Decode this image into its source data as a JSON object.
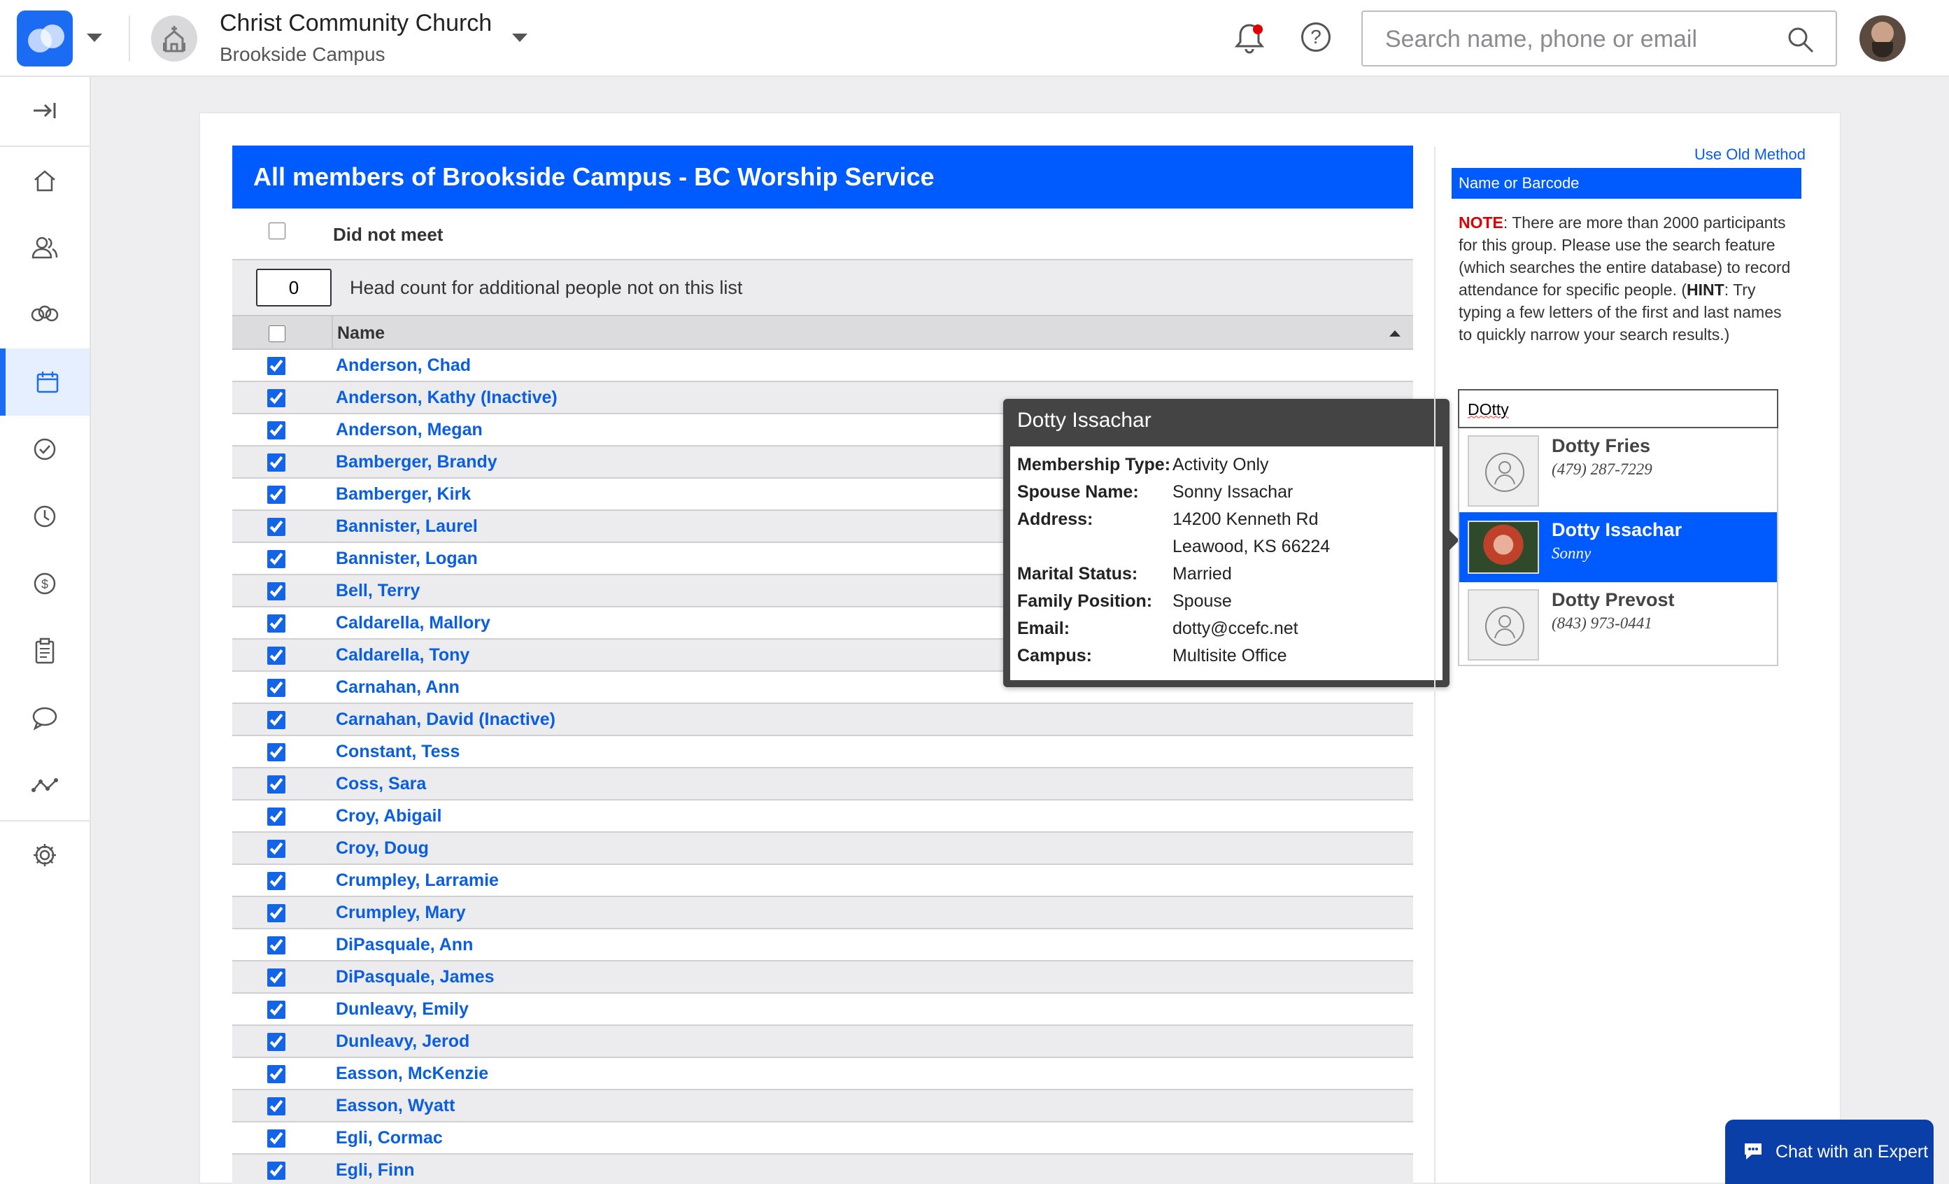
{
  "header": {
    "church_name": "Christ Community Church",
    "campus_name": "Brookside Campus",
    "search_placeholder": "Search name, phone or email",
    "notification_dot_color": "#e00000"
  },
  "sidebar": {
    "items": [
      {
        "icon": "collapse-sidebar-icon"
      },
      {
        "icon": "home-icon"
      },
      {
        "icon": "people-icon"
      },
      {
        "icon": "groups-icon"
      },
      {
        "icon": "calendar-icon",
        "active": true
      },
      {
        "icon": "check-circle-icon"
      },
      {
        "icon": "clock-icon"
      },
      {
        "icon": "dollar-icon"
      },
      {
        "icon": "clipboard-icon"
      },
      {
        "icon": "chat-icon"
      },
      {
        "icon": "analytics-icon"
      },
      {
        "icon": "gear-icon"
      }
    ]
  },
  "attendance": {
    "title": "All members of Brookside Campus - BC Worship Service",
    "did_not_meet_label": "Did not meet",
    "head_count_value": "0",
    "head_count_label": "Head count for additional people not on this list",
    "name_column": "Name",
    "members": [
      "Anderson, Chad",
      "Anderson, Kathy (Inactive)",
      "Anderson, Megan",
      "Bamberger, Brandy",
      "Bamberger, Kirk",
      "Bannister, Laurel",
      "Bannister, Logan",
      "Bell, Terry",
      "Caldarella, Mallory",
      "Caldarella, Tony",
      "Carnahan, Ann",
      "Carnahan, David (Inactive)",
      "Constant, Tess",
      "Coss, Sara",
      "Croy, Abigail",
      "Croy, Doug",
      "Crumpley, Larramie",
      "Crumpley, Mary",
      "DiPasquale, Ann",
      "DiPasquale, James",
      "Dunleavy, Emily",
      "Dunleavy, Jerod",
      "Easson, McKenzie",
      "Easson, Wyatt",
      "Egli, Cormac",
      "Egli, Finn"
    ]
  },
  "popup": {
    "title": "Dotty Issachar",
    "fields": [
      {
        "label": "Membership Type:",
        "value": "Activity Only"
      },
      {
        "label": "Spouse Name:",
        "value": "Sonny Issachar"
      },
      {
        "label": "Address:",
        "value": "14200 Kenneth Rd"
      },
      {
        "label": "",
        "value": "Leawood, KS 66224"
      },
      {
        "label": "Marital Status:",
        "value": "Married"
      },
      {
        "label": "Family Position:",
        "value": "Spouse"
      },
      {
        "label": "Email:",
        "value": "dotty@ccefc.net"
      },
      {
        "label": "Campus:",
        "value": "Multisite Office"
      }
    ]
  },
  "right_panel": {
    "use_old_method": "Use Old Method",
    "name_or_barcode": "Name or Barcode",
    "note_label": "NOTE",
    "note_text_1": ": There are more than 2000 participants for this group. Please use the search feature (which searches the entire database) to record attendance for specific people. (",
    "hint_label": "HINT",
    "note_text_2": ": Try typing a few letters of the first and last names to quickly narrow your search results.)",
    "search_value": "DOtty",
    "results": [
      {
        "name": "Dotty Fries",
        "sub": "(479) 287-7229",
        "selected": false
      },
      {
        "name": "Dotty Issachar",
        "sub": "Sonny",
        "selected": true
      },
      {
        "name": "Dotty Prevost",
        "sub": "(843) 973-0441",
        "selected": false
      }
    ]
  },
  "chat": {
    "label": "Chat with an Expert"
  },
  "colors": {
    "brand_blue": "#005bff",
    "link_blue": "#0a5ee0",
    "note_red": "#e00000"
  }
}
